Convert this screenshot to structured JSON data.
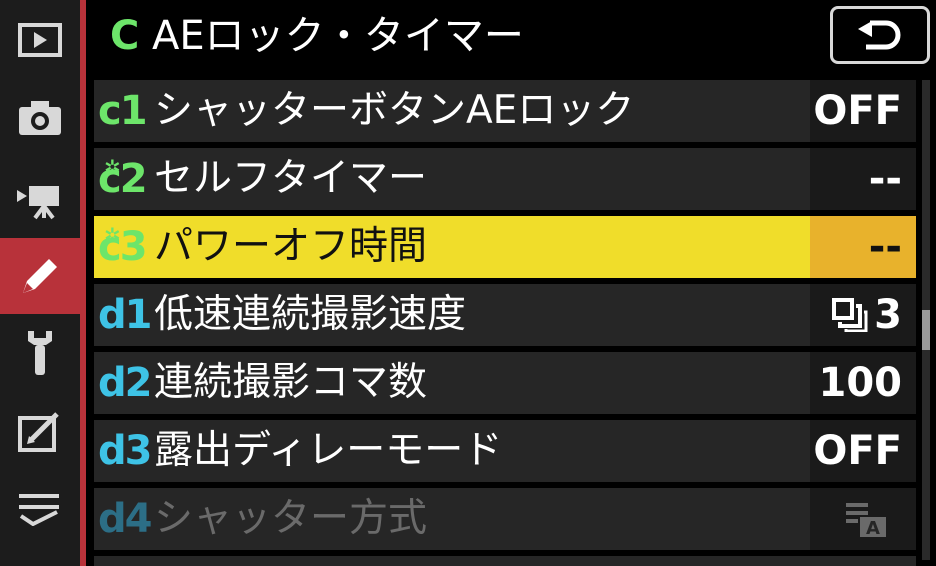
{
  "header": {
    "letter": "C",
    "title": "AEロック・タイマー"
  },
  "sidebar": {
    "items": [
      {
        "name": "playback-menu",
        "icon": "play-icon"
      },
      {
        "name": "photo-shooting-menu",
        "icon": "camera-icon"
      },
      {
        "name": "movie-shooting-menu",
        "icon": "movie-camera-icon"
      },
      {
        "name": "custom-settings-menu",
        "icon": "pencil-icon",
        "active": true
      },
      {
        "name": "setup-menu",
        "icon": "wrench-icon"
      },
      {
        "name": "retouch-menu",
        "icon": "retouch-icon"
      },
      {
        "name": "my-menu",
        "icon": "my-menu-icon"
      }
    ]
  },
  "menu": {
    "rows": [
      {
        "code": "c1",
        "label": "シャッターボタンAEロック",
        "value": "OFF"
      },
      {
        "code": "c2",
        "label": "セルフタイマー",
        "value": "--"
      },
      {
        "code": "c3",
        "label": "パワーオフ時間",
        "value": "--"
      },
      {
        "code": "d1",
        "label": "低速連続撮影速度",
        "value": "3"
      },
      {
        "code": "d2",
        "label": "連続撮影コマ数",
        "value": "100"
      },
      {
        "code": "d3",
        "label": "露出ディレーモード",
        "value": "OFF"
      },
      {
        "code": "d4",
        "label": "シャッター方式",
        "value": ""
      }
    ]
  },
  "colors": {
    "accent_red": "#b8323a",
    "highlight_yellow": "#f0dd2a",
    "value_orange": "#e8b22c",
    "green_code": "#6de56a",
    "cyan_code": "#3ec3e6"
  }
}
